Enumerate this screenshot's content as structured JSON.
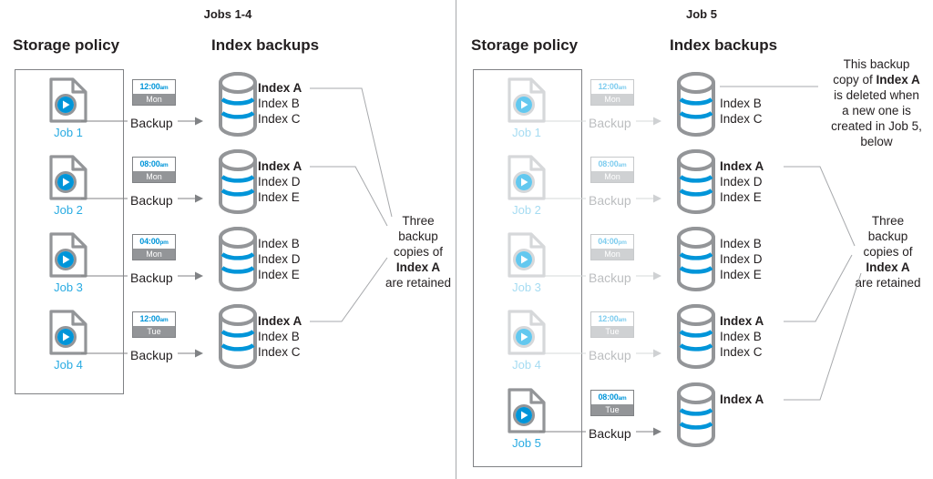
{
  "colors": {
    "accent_blue": "#29abe2",
    "band_blue": "#0095d9",
    "gray_outline": "#939598",
    "text_dark": "#231f20",
    "faded_gray": "#d6d8da",
    "faded_blue": "#a6dcf2",
    "divider": "#a7a9ac"
  },
  "left_panel": {
    "title": "Jobs 1-4",
    "columns": {
      "storage_policy": "Storage policy",
      "index_backups": "Index backups"
    },
    "rows": [
      {
        "job_label": "Job 1",
        "time": "12:00",
        "meridiem": "am",
        "day": "Mon",
        "backup_label": "Backup",
        "indexes": [
          {
            "text": "Index A",
            "bold": true
          },
          {
            "text": "Index B",
            "bold": false
          },
          {
            "text": "Index C",
            "bold": false
          }
        ]
      },
      {
        "job_label": "Job 2",
        "time": "08:00",
        "meridiem": "am",
        "day": "Mon",
        "backup_label": "Backup",
        "indexes": [
          {
            "text": "Index A",
            "bold": true
          },
          {
            "text": "Index D",
            "bold": false
          },
          {
            "text": "Index E",
            "bold": false
          }
        ]
      },
      {
        "job_label": "Job 3",
        "time": "04:00",
        "meridiem": "pm",
        "day": "Mon",
        "backup_label": "Backup",
        "indexes": [
          {
            "text": "Index B",
            "bold": false
          },
          {
            "text": "Index D",
            "bold": false
          },
          {
            "text": "Index E",
            "bold": false
          }
        ]
      },
      {
        "job_label": "Job 4",
        "time": "12:00",
        "meridiem": "am",
        "day": "Tue",
        "backup_label": "Backup",
        "indexes": [
          {
            "text": "Index A",
            "bold": true
          },
          {
            "text": "Index B",
            "bold": false
          },
          {
            "text": "Index C",
            "bold": false
          }
        ]
      }
    ],
    "callout": {
      "line1": "Three",
      "line2": "backup",
      "line3": "copies of",
      "line4": "Index A",
      "line5": "are retained"
    }
  },
  "right_panel": {
    "title": "Job 5",
    "columns": {
      "storage_policy": "Storage policy",
      "index_backups": "Index backups"
    },
    "rows": [
      {
        "job_label": "Job 1",
        "time": "12:00",
        "meridiem": "am",
        "day": "Mon",
        "backup_label": "Backup",
        "faded": true,
        "indexes": [
          {
            "text": "Index B",
            "bold": false
          },
          {
            "text": "Index C",
            "bold": false
          }
        ]
      },
      {
        "job_label": "Job 2",
        "time": "08:00",
        "meridiem": "am",
        "day": "Mon",
        "backup_label": "Backup",
        "faded": true,
        "indexes": [
          {
            "text": "Index A",
            "bold": true
          },
          {
            "text": "Index D",
            "bold": false
          },
          {
            "text": "Index E",
            "bold": false
          }
        ]
      },
      {
        "job_label": "Job 3",
        "time": "04:00",
        "meridiem": "pm",
        "day": "Mon",
        "backup_label": "Backup",
        "faded": true,
        "indexes": [
          {
            "text": "Index B",
            "bold": false
          },
          {
            "text": "Index D",
            "bold": false
          },
          {
            "text": "Index E",
            "bold": false
          }
        ]
      },
      {
        "job_label": "Job 4",
        "time": "12:00",
        "meridiem": "am",
        "day": "Tue",
        "backup_label": "Backup",
        "faded": true,
        "indexes": [
          {
            "text": "Index A",
            "bold": true
          },
          {
            "text": "Index B",
            "bold": false
          },
          {
            "text": "Index C",
            "bold": false
          }
        ]
      },
      {
        "job_label": "Job 5",
        "time": "08:00",
        "meridiem": "am",
        "day": "Tue",
        "backup_label": "Backup",
        "faded": false,
        "indexes": [
          {
            "text": "Index A",
            "bold": true
          }
        ]
      }
    ],
    "callout_deleted": {
      "line1": "This backup",
      "line2_a": "copy of ",
      "line2_b": "Index A",
      "line3": "is deleted when",
      "line4": "a new one is",
      "line5": "created in Job 5,",
      "line6": "below"
    },
    "callout_retained": {
      "line1": "Three",
      "line2": "backup",
      "line3": "copies of",
      "line4": "Index A",
      "line5": "are retained"
    }
  },
  "icons": {
    "job": "document-play-icon",
    "database": "database-cylinder-icon",
    "arrow": "arrow-right-icon"
  }
}
